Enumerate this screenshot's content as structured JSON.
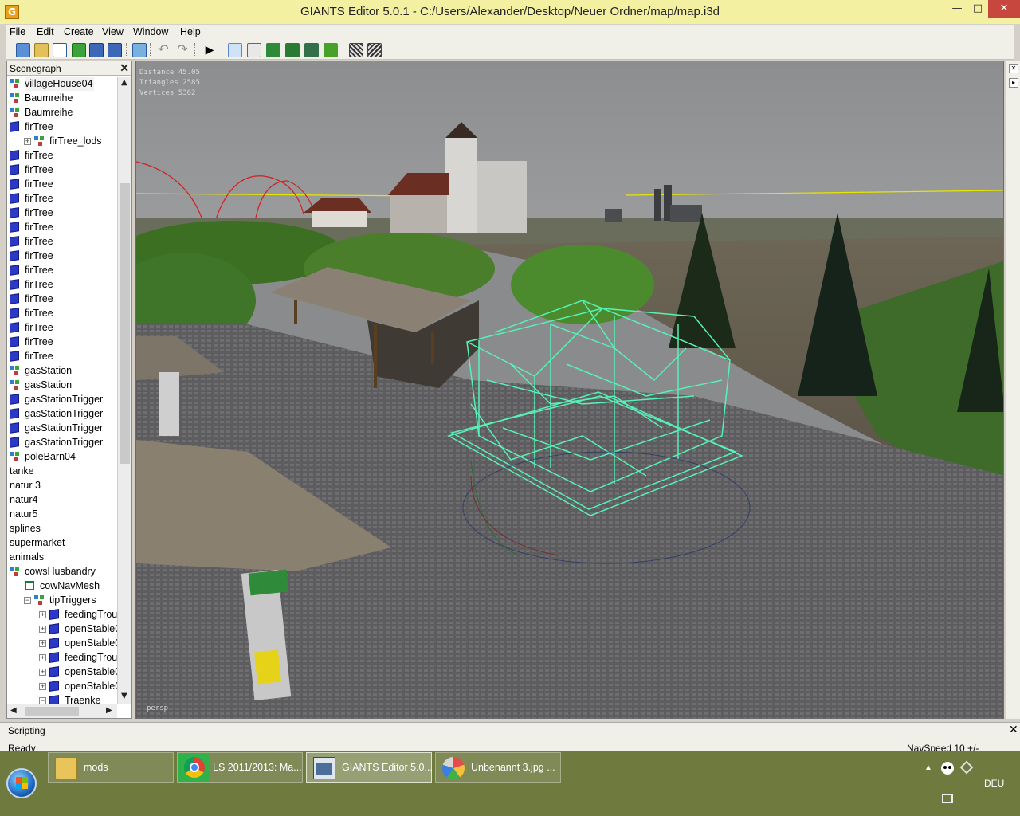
{
  "window": {
    "title": "GIANTS Editor 5.0.1 - C:/Users/Alexander/Desktop/Neuer Ordner/map/map.i3d",
    "app_icon": "G",
    "minimize": "—",
    "maximize": "□",
    "close": "✕"
  },
  "menu": {
    "file": "File",
    "edit": "Edit",
    "create": "Create",
    "view": "View",
    "window": "Window",
    "help": "Help"
  },
  "toolbar_icons": [
    "new-icon",
    "open-icon",
    "list-icon",
    "refresh-icon",
    "save-icon",
    "save-all-icon",
    "import-icon",
    "undo-icon",
    "redo-icon",
    "play-icon",
    "select-mode-icon",
    "move-mode-icon",
    "terrain-sculpt-icon",
    "terrain-paint-icon",
    "foliage-paint-icon",
    "foliage-icon",
    "grid-icon",
    "snap-icon"
  ],
  "scenegraph": {
    "title": "Scenegraph",
    "close": "✕",
    "items": [
      {
        "label": "villageHouse04",
        "icon": "transform",
        "indent": 0
      },
      {
        "label": "Baumreihe",
        "icon": "transform",
        "indent": 0
      },
      {
        "label": "Baumreihe",
        "icon": "transform",
        "indent": 0
      },
      {
        "label": "firTree",
        "icon": "cube",
        "indent": 0
      },
      {
        "label": "firTree_lods",
        "icon": "transform",
        "indent": 1,
        "expander": "+"
      },
      {
        "label": "firTree",
        "icon": "cube",
        "indent": 0
      },
      {
        "label": "firTree",
        "icon": "cube",
        "indent": 0
      },
      {
        "label": "firTree",
        "icon": "cube",
        "indent": 0
      },
      {
        "label": "firTree",
        "icon": "cube",
        "indent": 0
      },
      {
        "label": "firTree",
        "icon": "cube",
        "indent": 0
      },
      {
        "label": "firTree",
        "icon": "cube",
        "indent": 0
      },
      {
        "label": "firTree",
        "icon": "cube",
        "indent": 0
      },
      {
        "label": "firTree",
        "icon": "cube",
        "indent": 0
      },
      {
        "label": "firTree",
        "icon": "cube",
        "indent": 0
      },
      {
        "label": "firTree",
        "icon": "cube",
        "indent": 0
      },
      {
        "label": "firTree",
        "icon": "cube",
        "indent": 0
      },
      {
        "label": "firTree",
        "icon": "cube",
        "indent": 0
      },
      {
        "label": "firTree",
        "icon": "cube",
        "indent": 0
      },
      {
        "label": "firTree",
        "icon": "cube",
        "indent": 0
      },
      {
        "label": "firTree",
        "icon": "cube",
        "indent": 0
      },
      {
        "label": "gasStation",
        "icon": "transform",
        "indent": 0
      },
      {
        "label": "gasStation",
        "icon": "transform",
        "indent": 0
      },
      {
        "label": "gasStationTrigger",
        "icon": "cube",
        "indent": 0
      },
      {
        "label": "gasStationTrigger",
        "icon": "cube",
        "indent": 0
      },
      {
        "label": "gasStationTrigger",
        "icon": "cube",
        "indent": 0
      },
      {
        "label": "gasStationTrigger",
        "icon": "cube",
        "indent": 0
      },
      {
        "label": "poleBarn04",
        "icon": "transform",
        "indent": 0
      },
      {
        "label": "tanke",
        "icon": "none",
        "indent": 0
      },
      {
        "label": "natur 3",
        "icon": "none",
        "indent": 0
      },
      {
        "label": "natur4",
        "icon": "none",
        "indent": 0
      },
      {
        "label": "natur5",
        "icon": "none",
        "indent": 0
      },
      {
        "label": "splines",
        "icon": "none",
        "indent": 0
      },
      {
        "label": "supermarket",
        "icon": "none",
        "indent": 0
      },
      {
        "label": "animals",
        "icon": "none",
        "indent": 0
      },
      {
        "label": "cowsHusbandry",
        "icon": "transform",
        "indent": 0
      },
      {
        "label": "cowNavMesh",
        "icon": "navmesh",
        "indent": 1
      },
      {
        "label": "tipTriggers",
        "icon": "transform",
        "indent": 1,
        "expander": "−"
      },
      {
        "label": "feedingTrough",
        "icon": "cube",
        "indent": 2,
        "expander": "+"
      },
      {
        "label": "openStable01F",
        "icon": "cube",
        "indent": 2,
        "expander": "+"
      },
      {
        "label": "openStable01S",
        "icon": "cube",
        "indent": 2,
        "expander": "+"
      },
      {
        "label": "feedingTrough",
        "icon": "cube",
        "indent": 2,
        "expander": "+"
      },
      {
        "label": "openStable01S",
        "icon": "cube",
        "indent": 2,
        "expander": "+"
      },
      {
        "label": "openStable01S",
        "icon": "cube",
        "indent": 2,
        "expander": "+"
      },
      {
        "label": "Traenke",
        "icon": "cube",
        "indent": 2,
        "expander": "−"
      }
    ]
  },
  "viewport": {
    "stats": {
      "distance": "Distance 45.05",
      "triangles": "Triangles 2585",
      "vertices": "Vertices 5362"
    },
    "camera": "persp"
  },
  "scripting": {
    "title": "Scripting",
    "close": "✕"
  },
  "status": {
    "left": "Ready",
    "right": "NavSpeed 10 +/-"
  },
  "taskbar": {
    "tasks": [
      {
        "label": "mods",
        "icon": "folder-icon"
      },
      {
        "label": "LS 2011/2013: Ma...",
        "icon": "chrome-icon"
      },
      {
        "label": "GIANTS Editor 5.0...",
        "icon": "giants-editor-icon"
      },
      {
        "label": "Unbenannt 3.jpg ...",
        "icon": "paint-icon"
      }
    ],
    "language": "DEU",
    "tray_arrow": "▲"
  }
}
